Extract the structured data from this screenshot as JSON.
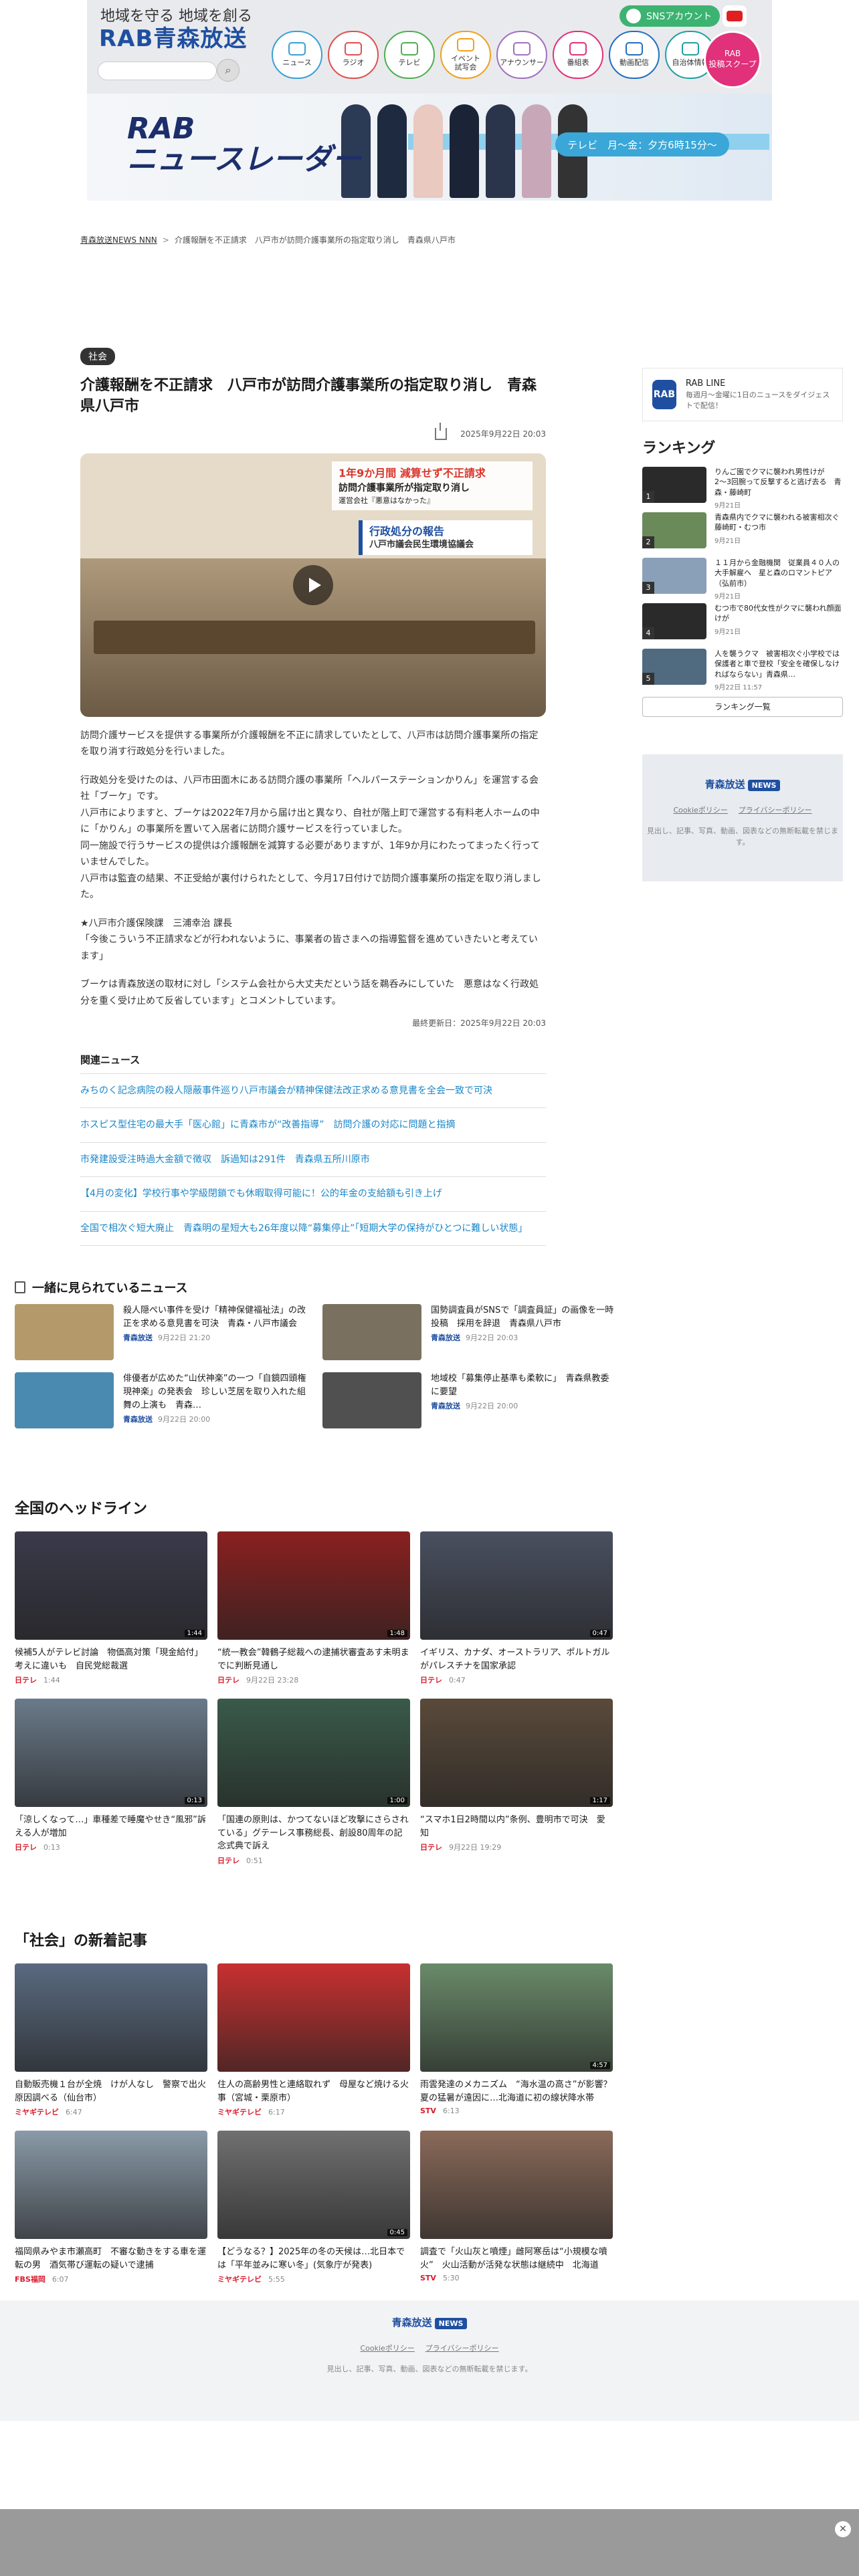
{
  "header": {
    "tagline": "地域を守る 地域を創る",
    "brand": "RAB青森放送",
    "sns_label": "SNSアカウント",
    "nav": [
      {
        "label": "ニュース",
        "color": "#3b9fd6"
      },
      {
        "label": "ラジオ",
        "color": "#e05050"
      },
      {
        "label": "テレビ",
        "color": "#4caf50"
      },
      {
        "label": "イベント\n試写会",
        "color": "#f0a020"
      },
      {
        "label": "アナウンサー",
        "color": "#a070c0"
      },
      {
        "label": "番組表",
        "color": "#e0317a"
      },
      {
        "label": "動画配信",
        "color": "#2070c0"
      },
      {
        "label": "自治体情報",
        "color": "#20a0a0"
      }
    ],
    "rab_post": "RAB\n投稿スクープ",
    "banner_title_1": "RAB",
    "banner_title_2": "ニュースレーダー",
    "banner_tag": "テレビ　月〜金：夕方6時15分〜"
  },
  "breadcrumb": [
    "青森放送NEWS NNN",
    "介護報酬を不正請求　八戸市が訪問介護事業所の指定取り消し　青森県八戸市"
  ],
  "article": {
    "category": "社会",
    "title": "介護報酬を不正請求　八戸市が訪問介護事業所の指定取り消し　青森県八戸市",
    "date": "2025年9月22日 20:03",
    "hero": {
      "caption_top": "1年9か月間 減算せず不正請求",
      "caption_main": "訪問介護事業所が指定取り消し",
      "caption_sub": "運営会社『悪意はなかった』",
      "board_1": "行政処分の報告",
      "board_2": "八戸市議会民生環境協議会"
    },
    "paragraphs": [
      "訪問介護サービスを提供する事業所が介護報酬を不正に請求していたとして、八戸市は訪問介護事業所の指定を取り消す行政処分を行いました。",
      "行政処分を受けたのは、八戸市田面木にある訪問介護の事業所「ヘルパーステーションかりん」を運営する会社「ブーケ」です。\n八戸市によりますと、ブーケは2022年7月から届け出と異なり、自社が階上町で運営する有料老人ホームの中に「かりん」の事業所を置いて入居者に訪問介護サービスを行っていました。\n同一施設で行うサービスの提供は介護報酬を減算する必要がありますが、1年9か月にわたってまったく行っていませんでした。\n八戸市は監査の結果、不正受給が裏付けられたとして、今月17日付けで訪問介護事業所の指定を取り消しました。",
      "★八戸市介護保険課　三浦幸治 課長\n「今後こういう不正請求などが行われないように、事業者の皆さまへの指導監督を進めていきたいと考えています」",
      "ブーケは青森放送の取材に対し「システム会社から大丈夫だという話を鵜呑みにしていた　悪意はなく行政処分を重く受け止めて反省しています」とコメントしています。"
    ],
    "updated": "最終更新日：2025年9月22日 20:03",
    "related_title": "関連ニュース",
    "related": [
      "みちのく記念病院の殺人隠蔽事件巡り八戸市議会が精神保健法改正求める意見書を全会一致で可決",
      "ホスピス型住宅の最大手「医心館」に青森市が“改善指導”　訪問介護の対応に問題と指摘",
      "市発建設受注時過大金額で徴収　訴過知は291件　青森県五所川原市",
      "【4月の変化】学校行事や学級閉鎖でも休暇取得可能に！公的年金の支給額も引き上げ",
      "全国で相次ぐ短大廃止　青森明の星短大も26年度以降“募集停止”「短期大学の保持がひとつに難しい状態」"
    ]
  },
  "sidebar": {
    "rabline_title": "RAB LINE",
    "rabline_desc": "毎週月〜金曜に1日のニュースをダイジェストで配信！",
    "ranking_title": "ランキング",
    "ranking": [
      {
        "text": "りんご園でクマに襲われ男性けが　2〜3回腕って反撃すると逃げ去る　青森・藤崎町",
        "date": "9月21日",
        "color": "#2a2a2a"
      },
      {
        "text": "青森県内でクマに襲われる被害相次ぐ　藤崎町・むつ市",
        "date": "9月21日",
        "color": "#6a8a5a"
      },
      {
        "text": "１１月から金融機関　従業員４０人の大手解雇へ　星と森のロマントピア（弘前市）",
        "date": "9月21日",
        "color": "#8aa0b8"
      },
      {
        "text": "むつ市で80代女性がクマに襲われ顔面けが",
        "date": "9月21日",
        "color": "#2a2a2a"
      },
      {
        "text": "人を襲うクマ　被害相次ぐ小学校では保護者と車で登校「安全を確保しなければならない」青森県…",
        "date": "9月22日 11:57",
        "color": "#506a80"
      }
    ],
    "ranking_more": "ランキング一覧",
    "foot_brand": "青森放送",
    "foot_news": "NEWS",
    "foot_links": [
      "Cookieポリシー",
      "プライバシーポリシー"
    ],
    "foot_copy": "見出し、記事、写真、動画、図表などの無断転載を禁じます。"
  },
  "also_read": {
    "title": "一緒に見られているニュース",
    "items": [
      {
        "text": "殺人隠ぺい事件を受け「精神保健福祉法」の改正を求める意見書を可決　青森・八戸市議会",
        "src": "青森放送",
        "date": "9月22日 21:20",
        "color": "#b49a6a",
        "dur": ""
      },
      {
        "text": "国勢調査員がSNSで「調査員証」の画像を一時投稿　採用を辞退　青森県八戸市",
        "src": "青森放送",
        "date": "9月22日 20:03",
        "color": "#7a7060",
        "dur": ""
      },
      {
        "text": "俳優者が広めた“山伏神楽”の一つ「自鏡四頭権現神楽」の発表会　珍しい芝居を取り入れた組舞の上演も　青森…",
        "src": "青森放送",
        "date": "9月22日 20:00",
        "color": "#4a8ab0",
        "dur": ""
      },
      {
        "text": "地域校「募集停止基準も柔軟に」　青森県教委に要望",
        "src": "青森放送",
        "date": "9月22日 20:00",
        "color": "#505050",
        "dur": ""
      }
    ]
  },
  "national": {
    "title": "全国のヘッドライン",
    "items": [
      {
        "text": "候補5人がテレビ討論　物価高対策「現金給付」考えに違いも　自民党総裁選",
        "src": "日テレ",
        "date": "1:44",
        "color": "#3a3a4a",
        "dur": "1:44"
      },
      {
        "text": "“統一教会”韓鶴子総裁への逮捕状審査あす未明までに判断見通し",
        "src": "日テレ",
        "date": "9月22日 23:28",
        "color": "#8a2020",
        "dur": "1:48"
      },
      {
        "text": "イギリス、カナダ、オーストラリア、ポルトガルがパレスチナを国家承認",
        "src": "日テレ",
        "date": "0:47",
        "color": "#4a5060",
        "dur": "0:47"
      },
      {
        "text": "「涼しくなって…」車種差で睡魔やせき“風邪”訴える人が増加",
        "src": "日テレ",
        "date": "0:13",
        "color": "#6a7a8a",
        "dur": "0:13"
      },
      {
        "text": "「国連の原則は、かつてないほど攻撃にさらされている」グテーレス事務総長、創設80周年の記念式典で訴え",
        "src": "日テレ",
        "date": "0:51",
        "color": "#3a5a4a",
        "dur": "1:00"
      },
      {
        "text": "“スマホ1日2時間以内”条例、豊明市で可決　愛知",
        "src": "日テレ",
        "date": "9月22日 19:29",
        "color": "#5a4a3a",
        "dur": "1:17"
      }
    ]
  },
  "social": {
    "title": "「社会」の新着記事",
    "items": [
      {
        "text": "自動販売機１台が全焼　けが人なし　警察で出火原因調べる（仙台市）",
        "src": "ミヤギテレビ",
        "date": "6:47",
        "color": "#5a6a80",
        "dur": ""
      },
      {
        "text": "住人の高齢男性と連絡取れず　母屋など焼ける火事（宮城・栗原市）",
        "src": "ミヤギテレビ",
        "date": "6:17",
        "color": "#c83030",
        "dur": ""
      },
      {
        "text": "雨雲発達のメカニズム　“海水温の高さ”が影響？　夏の猛暑が遠因に…北海道に初の線状降水帯",
        "src": "STV",
        "date": "6:13",
        "color": "#6a8a6a",
        "dur": "4:57"
      },
      {
        "text": "福岡県みやま市瀬高町　不審な動きをする車を運転の男　酒気帯び運転の疑いで逮捕",
        "src": "FBS福岡",
        "date": "6:07",
        "color": "#8a9aa8",
        "dur": ""
      },
      {
        "text": "【どうなる？】2025年の冬の天候は…北日本では「平年並みに寒い冬」(気象庁が発表)",
        "src": "ミヤギテレビ",
        "date": "5:55",
        "color": "#707070",
        "dur": "0:45"
      },
      {
        "text": "調査で「火山灰と噴煙」雌阿寒岳は“小規模な噴火”　火山活動が活発な状態は継続中　北海道",
        "src": "STV",
        "date": "5:30",
        "color": "#8a6a5a",
        "dur": ""
      }
    ]
  },
  "footer": {
    "brand": "青森放送",
    "news": "NEWS",
    "links": [
      "Cookieポリシー",
      "プライバシーポリシー"
    ],
    "copy": "見出し、記事、写真、動画、図表などの無断転載を禁じます。"
  }
}
